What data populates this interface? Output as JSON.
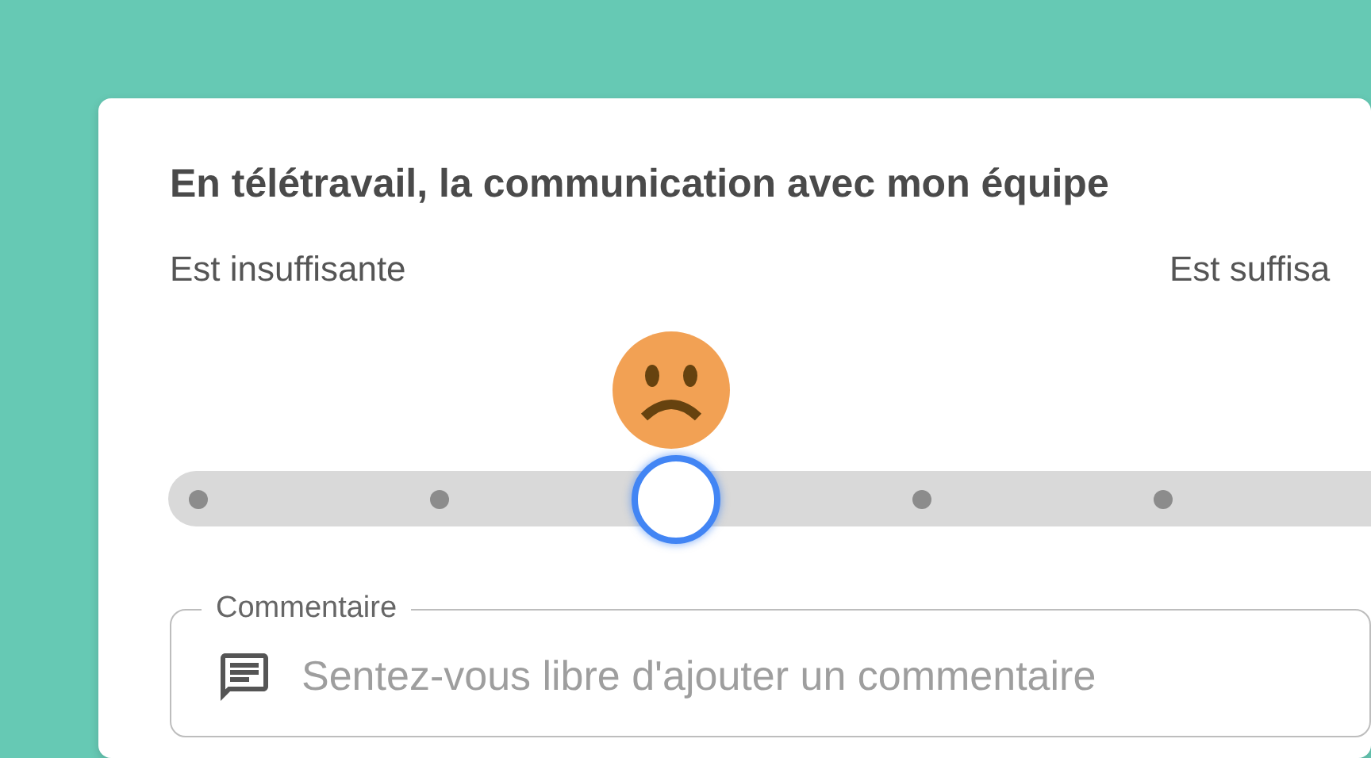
{
  "question": {
    "title": "En télétravail, la communication avec mon équipe",
    "label_low": "Est insuffisante",
    "label_high": "Est suffisa"
  },
  "slider": {
    "stops": [
      {
        "selected": false
      },
      {
        "selected": false
      },
      {
        "selected": true
      },
      {
        "selected": false
      },
      {
        "selected": false
      }
    ]
  },
  "comment": {
    "label": "Commentaire",
    "placeholder": "Sentez-vous libre d'ajouter un commentaire"
  }
}
